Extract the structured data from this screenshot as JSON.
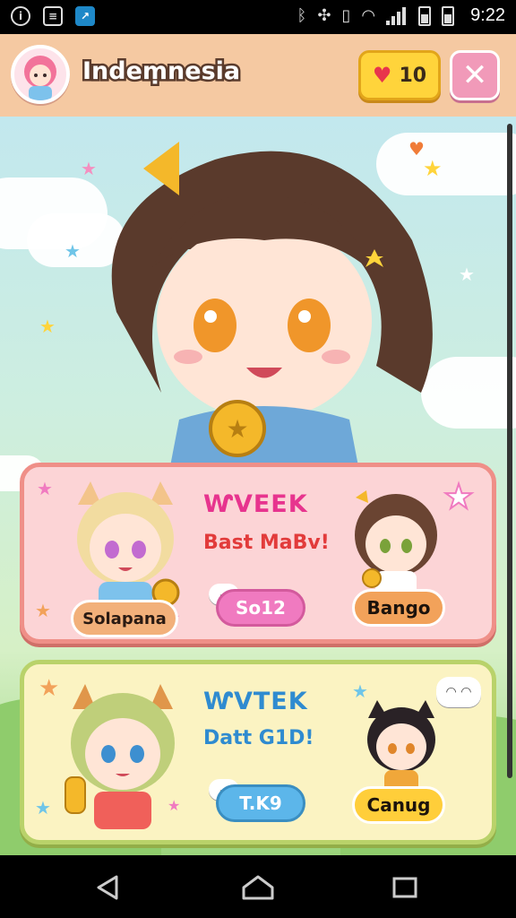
{
  "status_bar": {
    "time": "9:22",
    "left_icons": [
      "info-icon",
      "contact-card-icon",
      "app-badge-icon"
    ],
    "right_icons": [
      "bluetooth-icon",
      "data-saver-icon",
      "vibrate-icon",
      "wifi-icon",
      "signal-icon",
      "battery-icon",
      "battery-icon"
    ]
  },
  "header": {
    "title": "Indeṃnesia",
    "hearts_count": "10",
    "close_icon": "close-icon"
  },
  "cards": [
    {
      "title": "ⱲVEEK",
      "subtitle": "Bast MaBv!",
      "left_name": "Solapana",
      "middle_button": "So12",
      "right_name": "Bango",
      "speech_icon": "speech-bubble-icon"
    },
    {
      "title": "ⱲVTEK",
      "subtitle": "Datt G1D!",
      "middle_button": "T.K9",
      "right_name": "Canug",
      "speech_icon": "speech-bubble-icon"
    }
  ],
  "nav": {
    "back_icon": "back-triangle-icon",
    "home_icon": "home-icon",
    "recents_icon": "recents-square-icon"
  },
  "colors": {
    "header_bg": "#f5c9a2",
    "hearts_bg": "#ffd43b",
    "close_bg": "#f19ab9",
    "card_pink": "#fcd4d6",
    "card_yellow": "#fbf3c2"
  }
}
